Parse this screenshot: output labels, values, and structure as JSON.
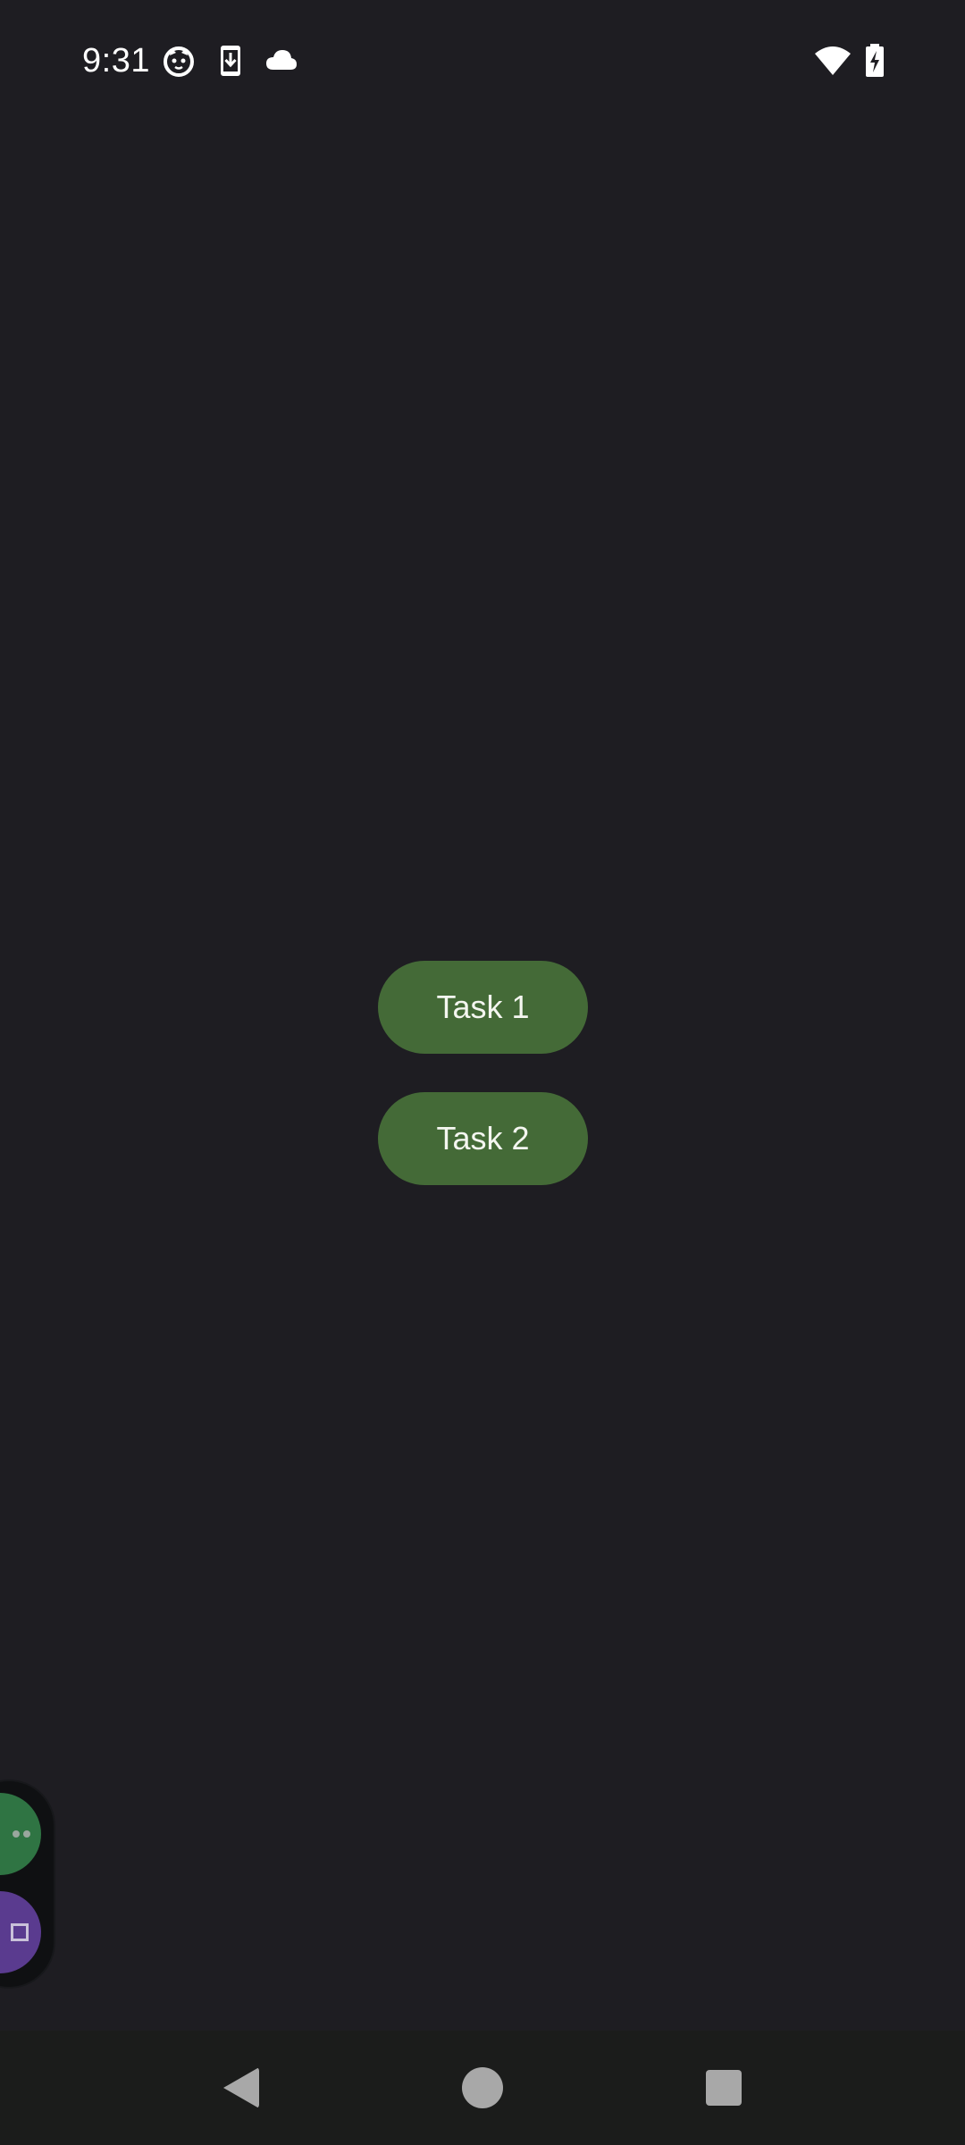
{
  "status_bar": {
    "time": "9:31",
    "left_icons": [
      "cat-face-icon",
      "phone-download-icon",
      "cloud-icon"
    ],
    "right_icons": [
      "wifi-icon",
      "battery-charging-icon"
    ]
  },
  "main": {
    "buttons": [
      {
        "label": "Task 1"
      },
      {
        "label": "Task 2"
      }
    ],
    "button_color": "#446a37"
  },
  "floating_bubble": {
    "icons": [
      "more-icon",
      "window-icon"
    ]
  },
  "nav_bar": {
    "icons": [
      "back-icon",
      "home-icon",
      "recents-icon"
    ]
  },
  "colors": {
    "background": "#1e1d22",
    "nav_background": "#1b1c1b"
  }
}
